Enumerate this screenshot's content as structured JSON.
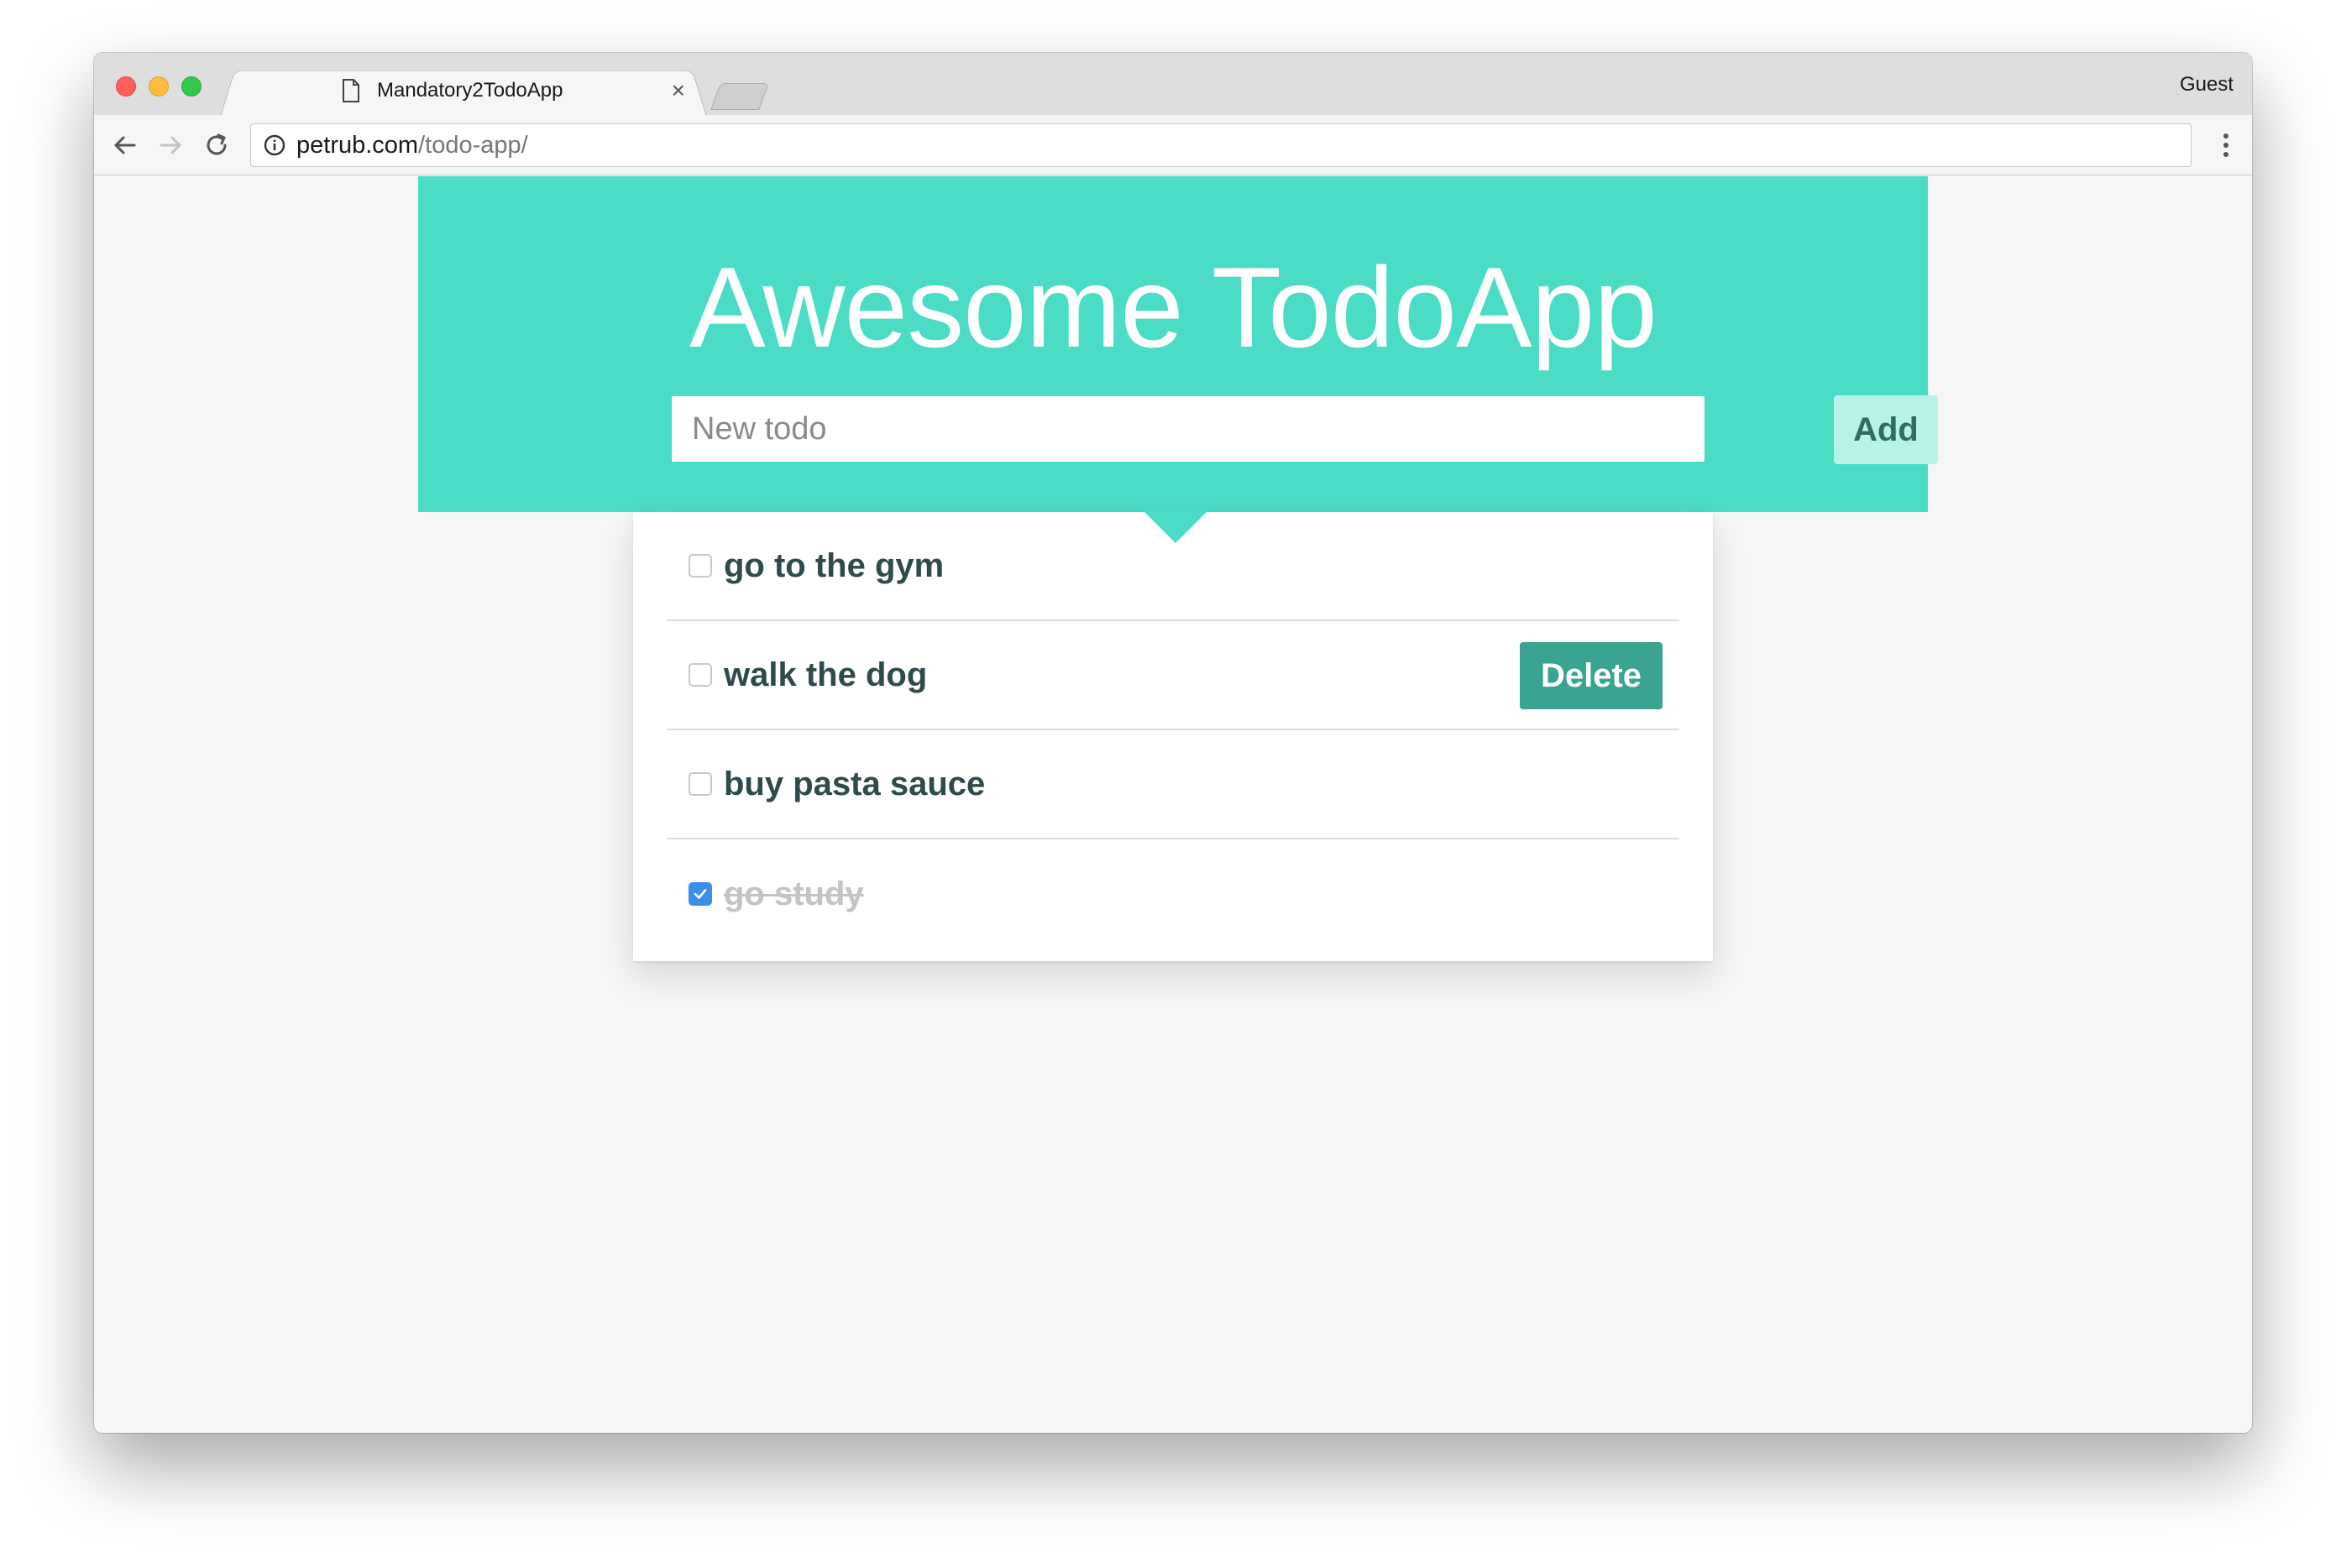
{
  "browser": {
    "tab_title": "Mandatory2TodoApp",
    "tab_close": "×",
    "profile_label": "Guest",
    "url_host": "petrub.com",
    "url_path": "/todo-app/"
  },
  "app": {
    "title": "Awesome TodoApp",
    "input_placeholder": "New todo",
    "add_label": "Add",
    "accent_color": "#4adcc5",
    "todos": [
      {
        "text": "go to the gym",
        "done": false
      },
      {
        "text": "walk the dog",
        "done": false,
        "delete_label": "Delete"
      },
      {
        "text": "buy pasta sauce",
        "done": false
      },
      {
        "text": "go study",
        "done": true
      }
    ]
  }
}
